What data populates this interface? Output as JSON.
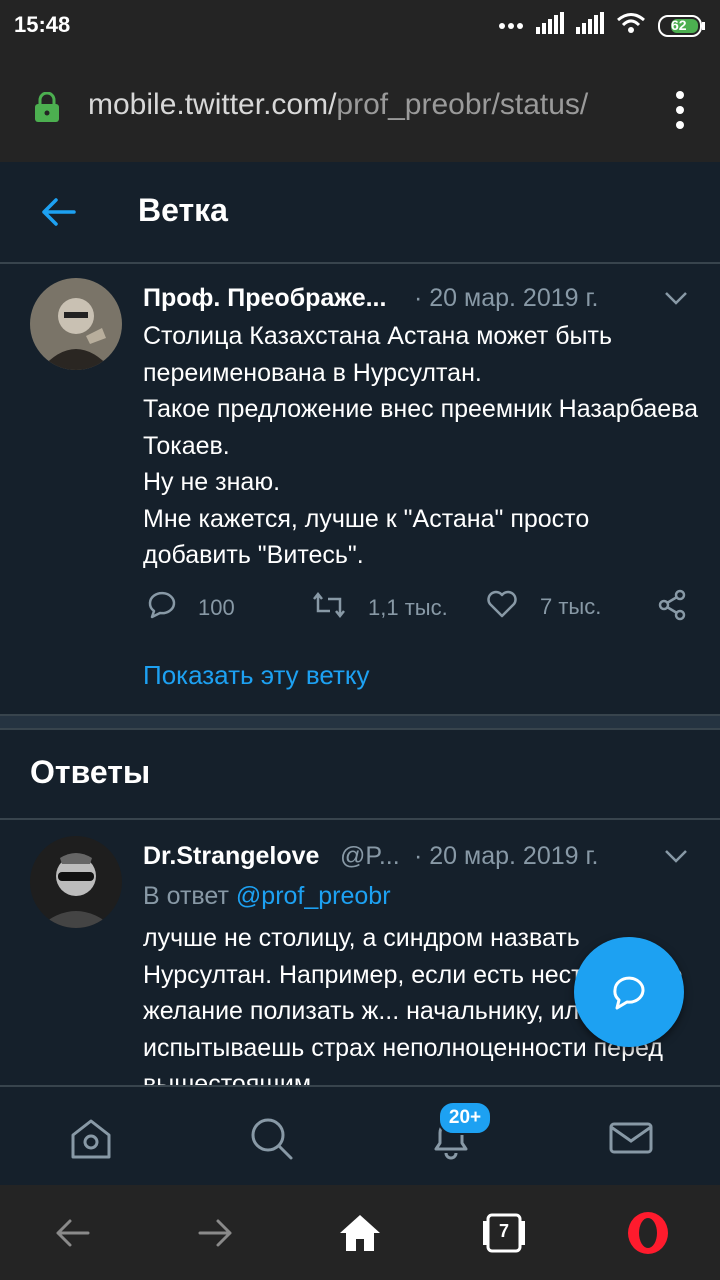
{
  "status_bar": {
    "time": "15:48",
    "battery": "62"
  },
  "browser": {
    "url_main": "mobile.twitter.com/",
    "url_path": "prof_preobr/status/",
    "tabs_count": "7"
  },
  "header": {
    "title": "Ветка"
  },
  "tweet": {
    "author_name": "Проф. Преображе...",
    "date": "· 20 мар. 2019 г.",
    "text": "Столица Казахстана Астана может быть переименована в Нурсултан.\nТакое предложение внес преемник Назарбаева Токаев.\nНу не знаю.\nМне кажется, лучше к \"Астана\" просто добавить \"Витесь\".",
    "replies": "100",
    "retweets": "1,1 тыс.",
    "likes": "7 тыс.",
    "show_thread": "Показать эту ветку"
  },
  "replies_section": {
    "title": "Ответы"
  },
  "reply": {
    "author_name": "Dr.Strangelove",
    "handle": "@P...",
    "date": "· 20 мар. 2019 г.",
    "in_reply_prefix": "В ответ",
    "in_reply_handle": "@prof_preobr",
    "text": "лучше не столицу, а синдром назвать Нурсултан. Например, если есть нестерпимое желание полизать ж... начальнику, или испытываешь страх неполноценности перед вышестоящим"
  },
  "tab_bar": {
    "notifications_badge": "20+"
  }
}
